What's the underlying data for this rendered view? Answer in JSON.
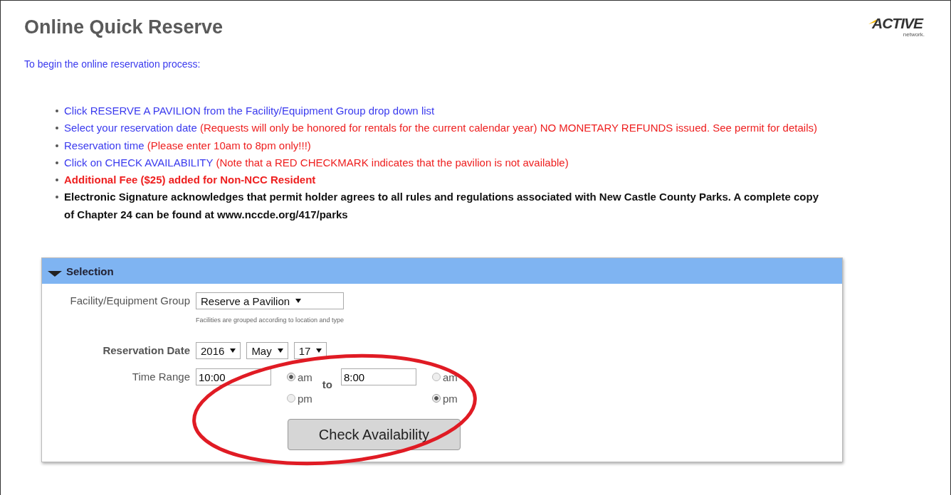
{
  "title": "Online Quick Reserve",
  "logo": {
    "name": "ACTIVE",
    "tagline": "network."
  },
  "intro": "To begin the online reservation process:",
  "instructions": [
    {
      "segments": [
        {
          "kind": "note",
          "text": "Click RESERVE A PAVILION from the Facility/Equipment Group drop down list"
        }
      ]
    },
    {
      "segments": [
        {
          "kind": "note",
          "text": "Select your reservation date"
        },
        {
          "kind": "warning",
          "text": "(Requests will only be honored for rentals for the current calendar year) NO MONETARY REFUNDS issued. See permit for details)"
        }
      ]
    },
    {
      "segments": [
        {
          "kind": "note",
          "text": "Reservation time"
        },
        {
          "kind": "warning",
          "text": "(Please enter 10am to 8pm only!!!)"
        }
      ]
    },
    {
      "segments": [
        {
          "kind": "note",
          "text": "Click on CHECK AVAILABILITY"
        },
        {
          "kind": "warning",
          "text": "(Note that a RED CHECKMARK indicates that the pavilion is not available)"
        }
      ]
    },
    {
      "segments": [
        {
          "kind": "fee",
          "text": "Additional Fee ($25) added for Non-NCC Resident"
        }
      ]
    },
    {
      "segments": [
        {
          "kind": "legal",
          "text": "Electronic Signature acknowledges that permit holder agrees to all rules and regulations associated with New Castle County Parks. A complete copy of Chapter 24 can be found at www.nccde.org/417/parks"
        }
      ]
    }
  ],
  "panel": {
    "title": "Selection",
    "expanded": true,
    "facility": {
      "label": "Facility/Equipment Group",
      "value": "Reserve a Pavilion",
      "hint": "Facilities are grouped according to location and type"
    },
    "date": {
      "label": "Reservation Date",
      "year": "2016",
      "month": "May",
      "day": "17"
    },
    "time": {
      "label": "Time Range",
      "connector": "to",
      "start": {
        "value": "10:00",
        "options": [
          {
            "label": "am",
            "selected": true
          },
          {
            "label": "pm",
            "selected": false
          }
        ]
      },
      "end": {
        "value": "8:00",
        "options": [
          {
            "label": "am",
            "selected": false
          },
          {
            "label": "pm",
            "selected": true
          }
        ]
      }
    },
    "button": "Check Availability"
  }
}
